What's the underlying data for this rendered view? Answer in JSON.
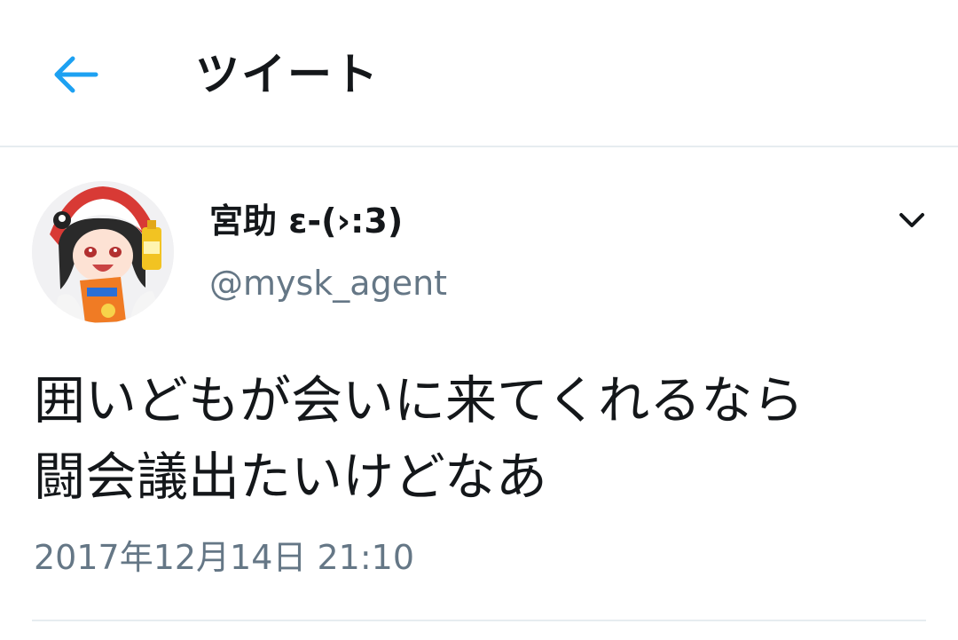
{
  "header": {
    "back_icon": "arrow-left-icon",
    "title": "ツイート"
  },
  "tweet": {
    "author": {
      "display_name": "宮助 ε-(›:3)",
      "handle": "@mysk_agent",
      "avatar_icon": "anime-character-avatar"
    },
    "menu_icon": "chevron-down-icon",
    "text": "囲いどもが会いに来てくれるなら\n闘会議出たいけどなあ",
    "timestamp": "2017年12月14日 21:10"
  },
  "colors": {
    "accent": "#1da1f2",
    "text_primary": "#14171a",
    "text_secondary": "#657786",
    "divider": "#e6ecf0"
  }
}
